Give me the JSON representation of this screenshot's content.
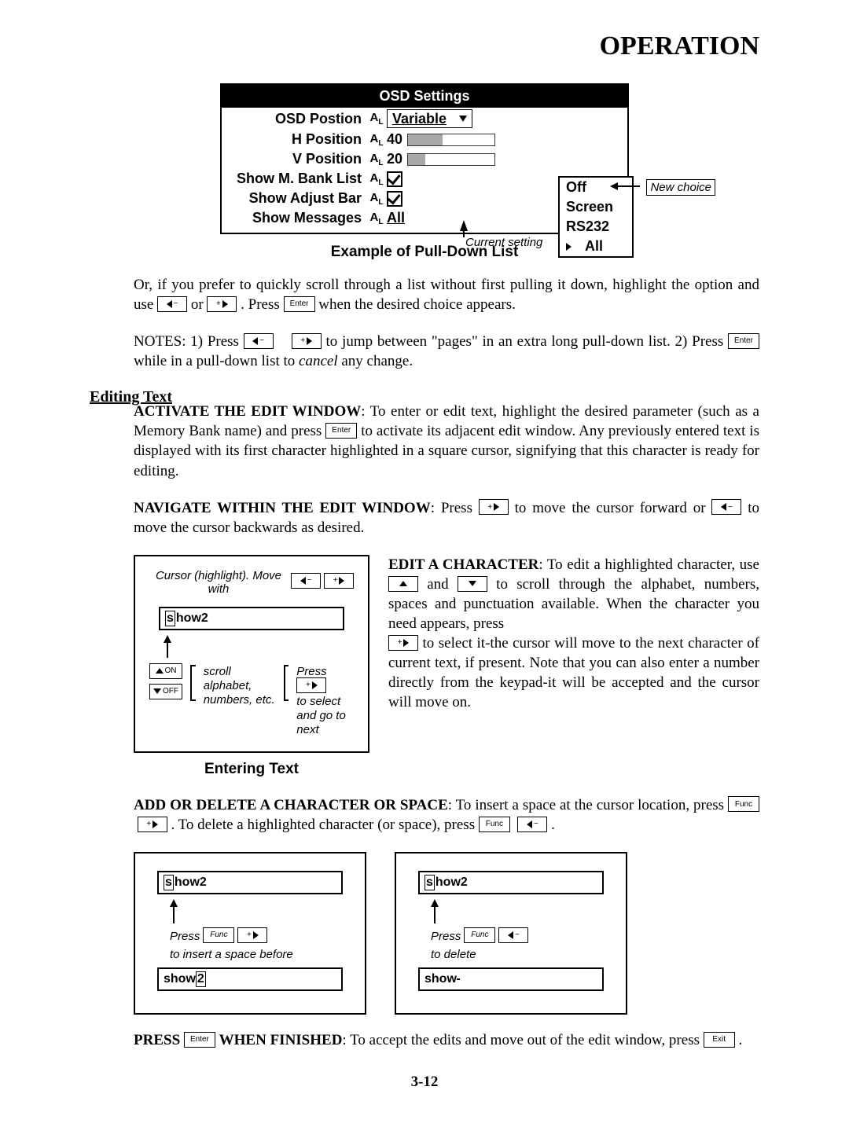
{
  "header": {
    "title": "OPERATION"
  },
  "osd": {
    "title": "OSD Settings",
    "rows": {
      "position": {
        "label": "OSD Postion",
        "value": "Variable"
      },
      "h": {
        "label": "H  Position",
        "value": "40",
        "fill_pct": 40
      },
      "v": {
        "label": "V  Position",
        "value": "20",
        "fill_pct": 20
      },
      "mbank": {
        "label": "Show M. Bank List"
      },
      "adjust": {
        "label": "Show Adjust Bar"
      },
      "messages": {
        "label": "Show Messages",
        "value": "All"
      }
    },
    "dropdown": [
      "Off",
      "Screen",
      "RS232",
      "All"
    ],
    "current_setting": "Current setting",
    "new_choice": "New choice"
  },
  "captions": {
    "pulldown": "Example of Pull-Down List",
    "entering": "Entering Text"
  },
  "paras": {
    "or_if": "Or, if you prefer to quickly scroll through a list without first pulling it down, highlight the option and use ",
    "or_if_mid": " or ",
    "or_if_2": " . Press ",
    "or_if_3": " when the desired choice appears.",
    "notes_a": "NOTES: 1) Press ",
    "notes_b": " to jump between \"pages\" in an extra long pull-down list. 2) Press ",
    "notes_c": " while in a pull-down list to ",
    "notes_cancel": "cancel",
    "notes_d": " any change.",
    "editing_head": "Editing Text",
    "activate_lead": "ACTIVATE THE EDIT WINDOW",
    "activate_body1": ": To enter or edit text, highlight the desired parameter (such as a Memory Bank name) and press ",
    "activate_body2": " to activate its adjacent edit window. Any previously entered text is displayed with its first character highlighted in a square cursor, signifying that this character is ready for editing.",
    "nav_lead": "NAVIGATE WITHIN THE EDIT WINDOW",
    "nav_1": ": Press ",
    "nav_2": " to move the cursor forward or ",
    "nav_3": " to move the cursor backwards as desired.",
    "edit_lead": "EDIT A CHARACTER",
    "edit_1": ": To edit a highlighted character, use ",
    "edit_2": " and ",
    "edit_3": " to scroll through the alphabet, numbers, spaces and punctuation available. When the character you need appears, press ",
    "edit_4": " to select it-the cursor will move to the next character of current text, if present. Note that you can also enter a number directly from the keypad-it will be accepted and the cursor will move on.",
    "add_lead": "ADD OR DELETE A CHARACTER OR SPACE",
    "add_1": ": To insert a space at the cursor location, press ",
    "add_2": " . To delete a highlighted character (or space), press ",
    "add_3": " .",
    "press_lead": "PRESS ",
    "press_mid": " WHEN FINISHED",
    "press_1": ": To accept the edits and move out of the edit window, press ",
    "press_2": " ."
  },
  "fig": {
    "cursor_hint": "Cursor (highlight). Move with",
    "sample_text": "show2",
    "sample_text_first": "s",
    "sample_text_rest": "how2",
    "k_on": "ON",
    "k_off": "OFF",
    "scroll_text": "scroll alphabet, numbers, etc.",
    "press": "Press",
    "to_select": "to select and go to next",
    "insert_hint": "to insert a space before",
    "delete_hint": "to delete",
    "sample_after_insert_a": "show ",
    "sample_after_insert_b": "2",
    "sample_after_delete_a": "show",
    "sample_after_delete_b": ""
  },
  "keys": {
    "enter": "Enter",
    "func": "Func",
    "exit": "Exit"
  },
  "page_number": "3-12"
}
